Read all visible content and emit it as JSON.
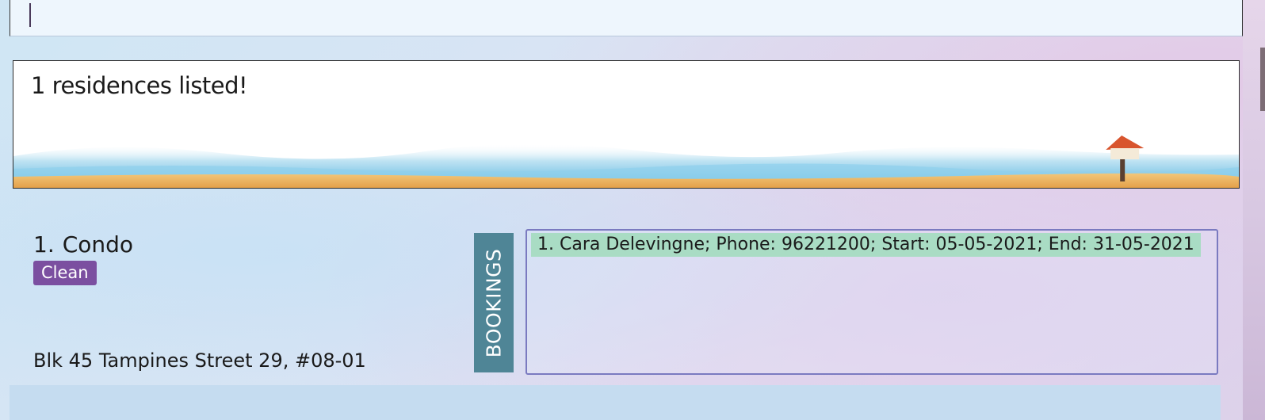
{
  "result": {
    "message": "1 residences listed!"
  },
  "residence": {
    "index": "1.",
    "name": "Condo",
    "tag": "Clean",
    "address": "Blk 45 Tampines Street 29, #08-01",
    "bookings_label": "BOOKINGS",
    "bookings": [
      "1. Cara Delevingne; Phone: 96221200; Start: 05-05-2021; End: 31-05-2021"
    ]
  },
  "colors": {
    "tag_bg": "#7b4fa0",
    "bookings_tab_bg": "#4f8596",
    "booking_item_bg": "#a9dcc4",
    "bookings_border": "#7a7ac0"
  }
}
